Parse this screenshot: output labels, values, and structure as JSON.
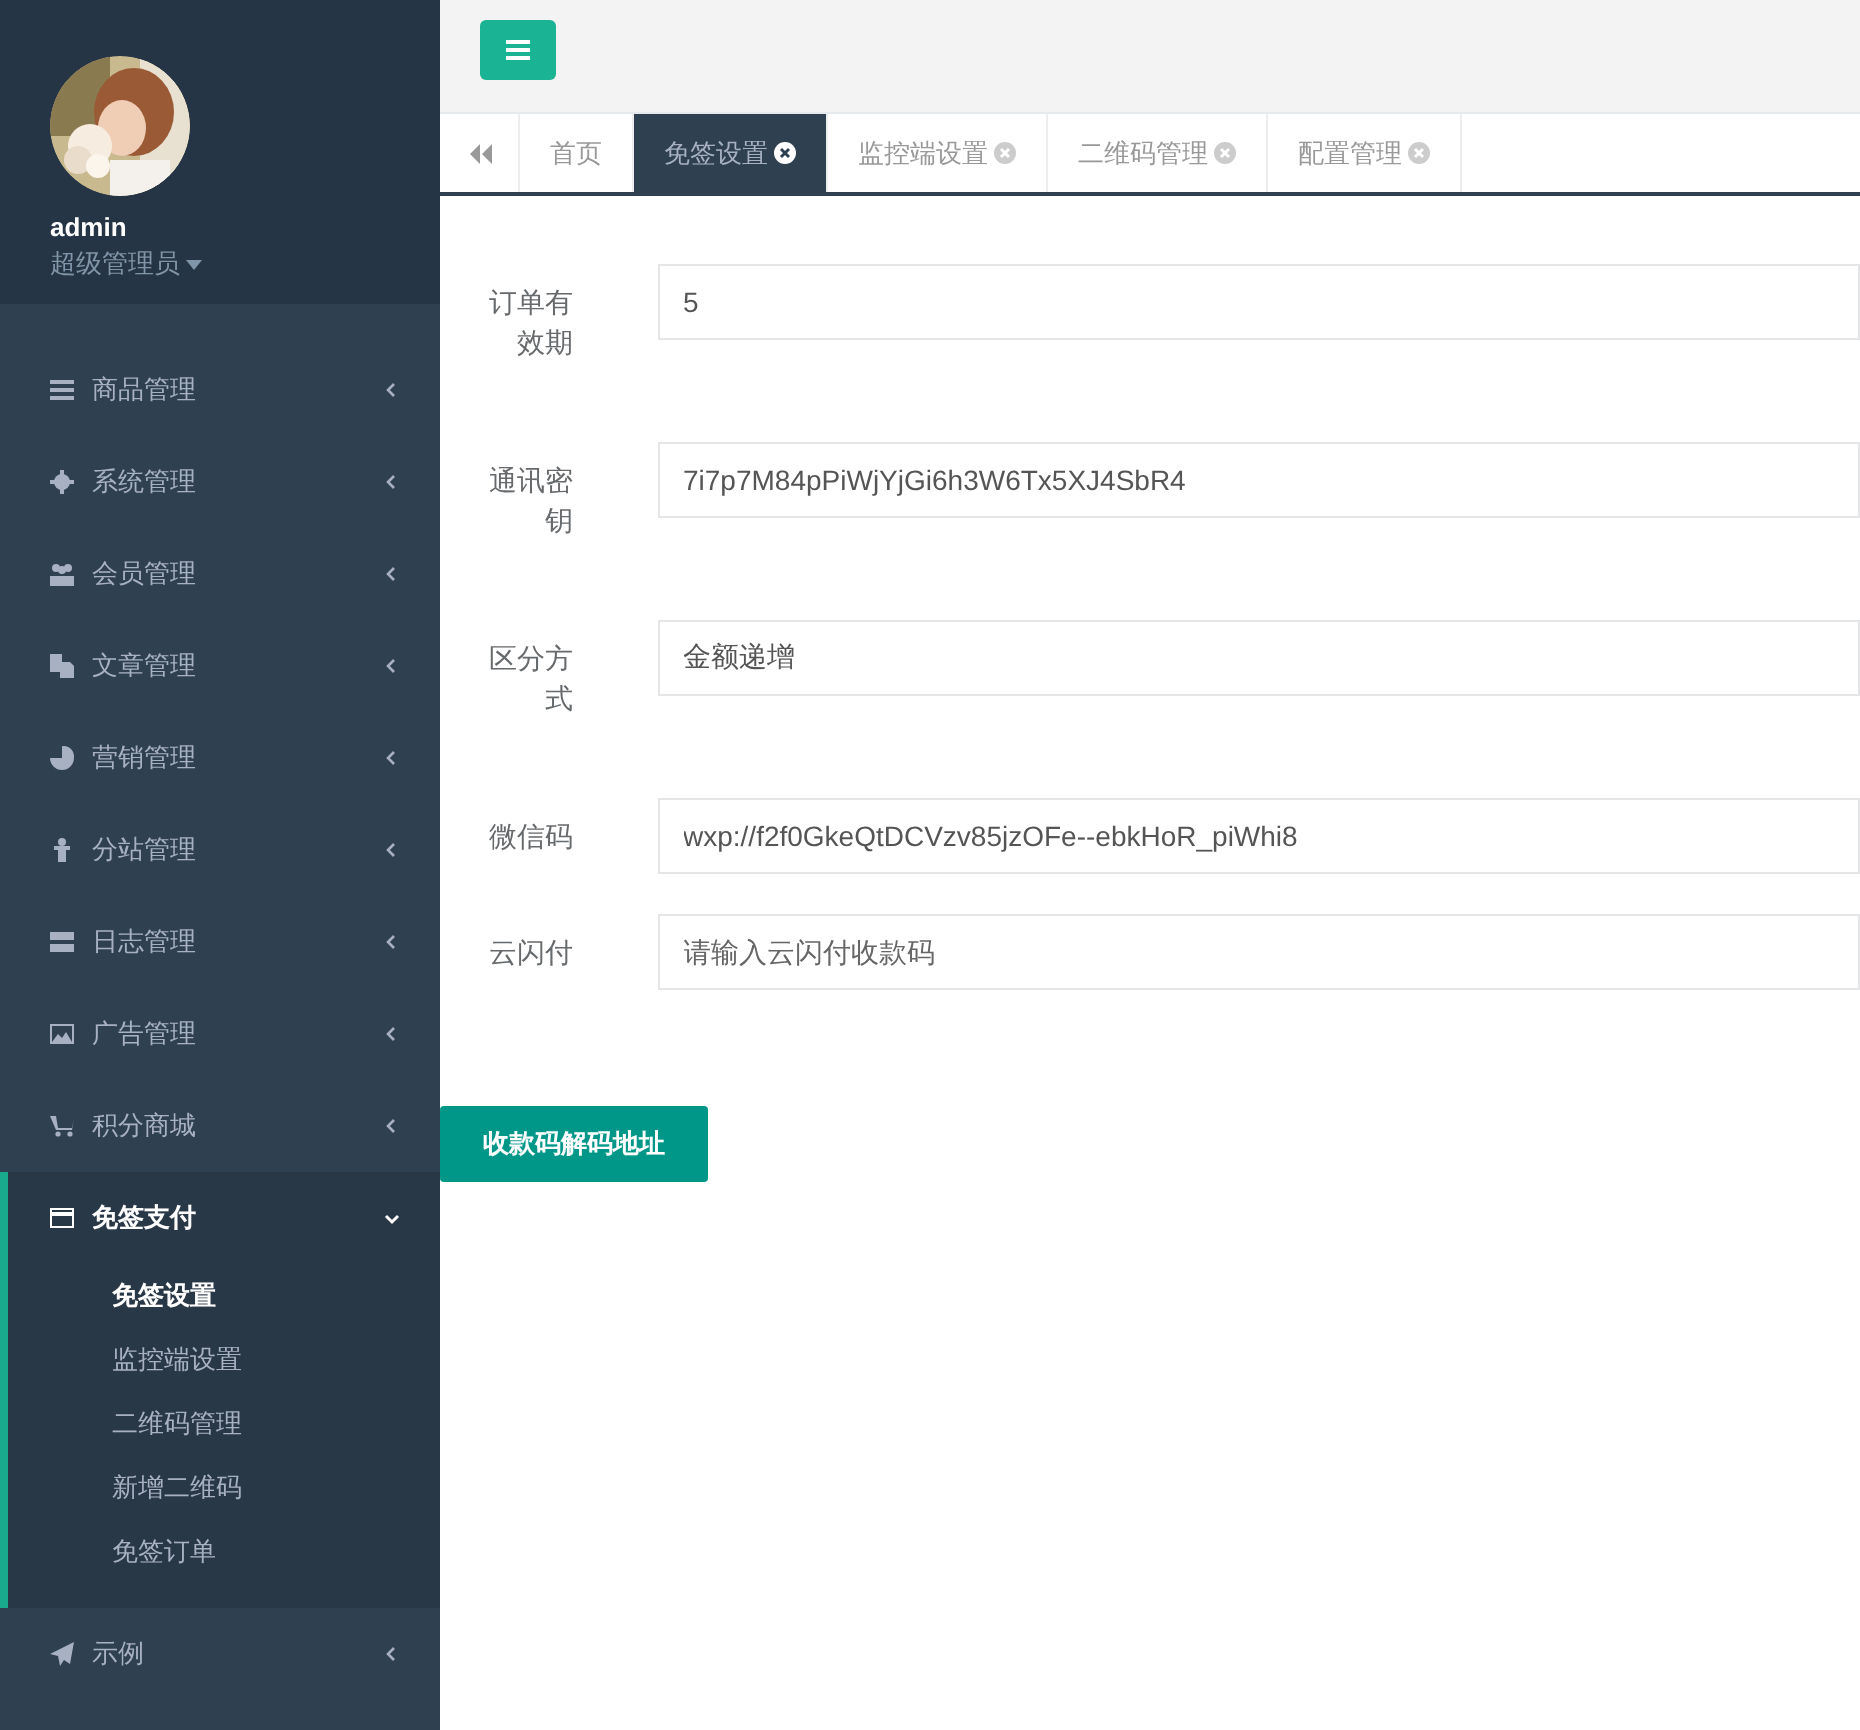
{
  "profile": {
    "name": "admin",
    "role": "超级管理员"
  },
  "sidebar": {
    "items": [
      {
        "label": "商品管理",
        "expanded": false
      },
      {
        "label": "系统管理",
        "expanded": false
      },
      {
        "label": "会员管理",
        "expanded": false
      },
      {
        "label": "文章管理",
        "expanded": false
      },
      {
        "label": "营销管理",
        "expanded": false
      },
      {
        "label": "分站管理",
        "expanded": false
      },
      {
        "label": "日志管理",
        "expanded": false
      },
      {
        "label": "广告管理",
        "expanded": false
      },
      {
        "label": "积分商城",
        "expanded": false
      },
      {
        "label": "免签支付",
        "expanded": true,
        "children": [
          {
            "label": "免签设置",
            "selected": true
          },
          {
            "label": "监控端设置",
            "selected": false
          },
          {
            "label": "二维码管理",
            "selected": false
          },
          {
            "label": "新增二维码",
            "selected": false
          },
          {
            "label": "免签订单",
            "selected": false
          }
        ]
      },
      {
        "label": "示例",
        "expanded": false
      }
    ]
  },
  "tabs": [
    {
      "label": "首页",
      "selected": false,
      "closable": false
    },
    {
      "label": "免签设置",
      "selected": true,
      "closable": true
    },
    {
      "label": "监控端设置",
      "selected": false,
      "closable": true
    },
    {
      "label": "二维码管理",
      "selected": false,
      "closable": true
    },
    {
      "label": "配置管理",
      "selected": false,
      "closable": true
    }
  ],
  "form": {
    "fields": [
      {
        "label": "订单有效期",
        "value": "5"
      },
      {
        "label": "通讯密钥",
        "value": "7i7p7M84pPiWjYjGi6h3W6Tx5XJ4SbR4"
      },
      {
        "label": "区分方式",
        "value": "金额递增"
      },
      {
        "label": "微信码",
        "value": "wxp://f2f0GkeQtDCVzv85jzOFe--ebkHoR_piWhi8"
      },
      {
        "label": "云闪付",
        "placeholder": "请输入云闪付收款码"
      }
    ],
    "button": "收款码解码地址"
  }
}
